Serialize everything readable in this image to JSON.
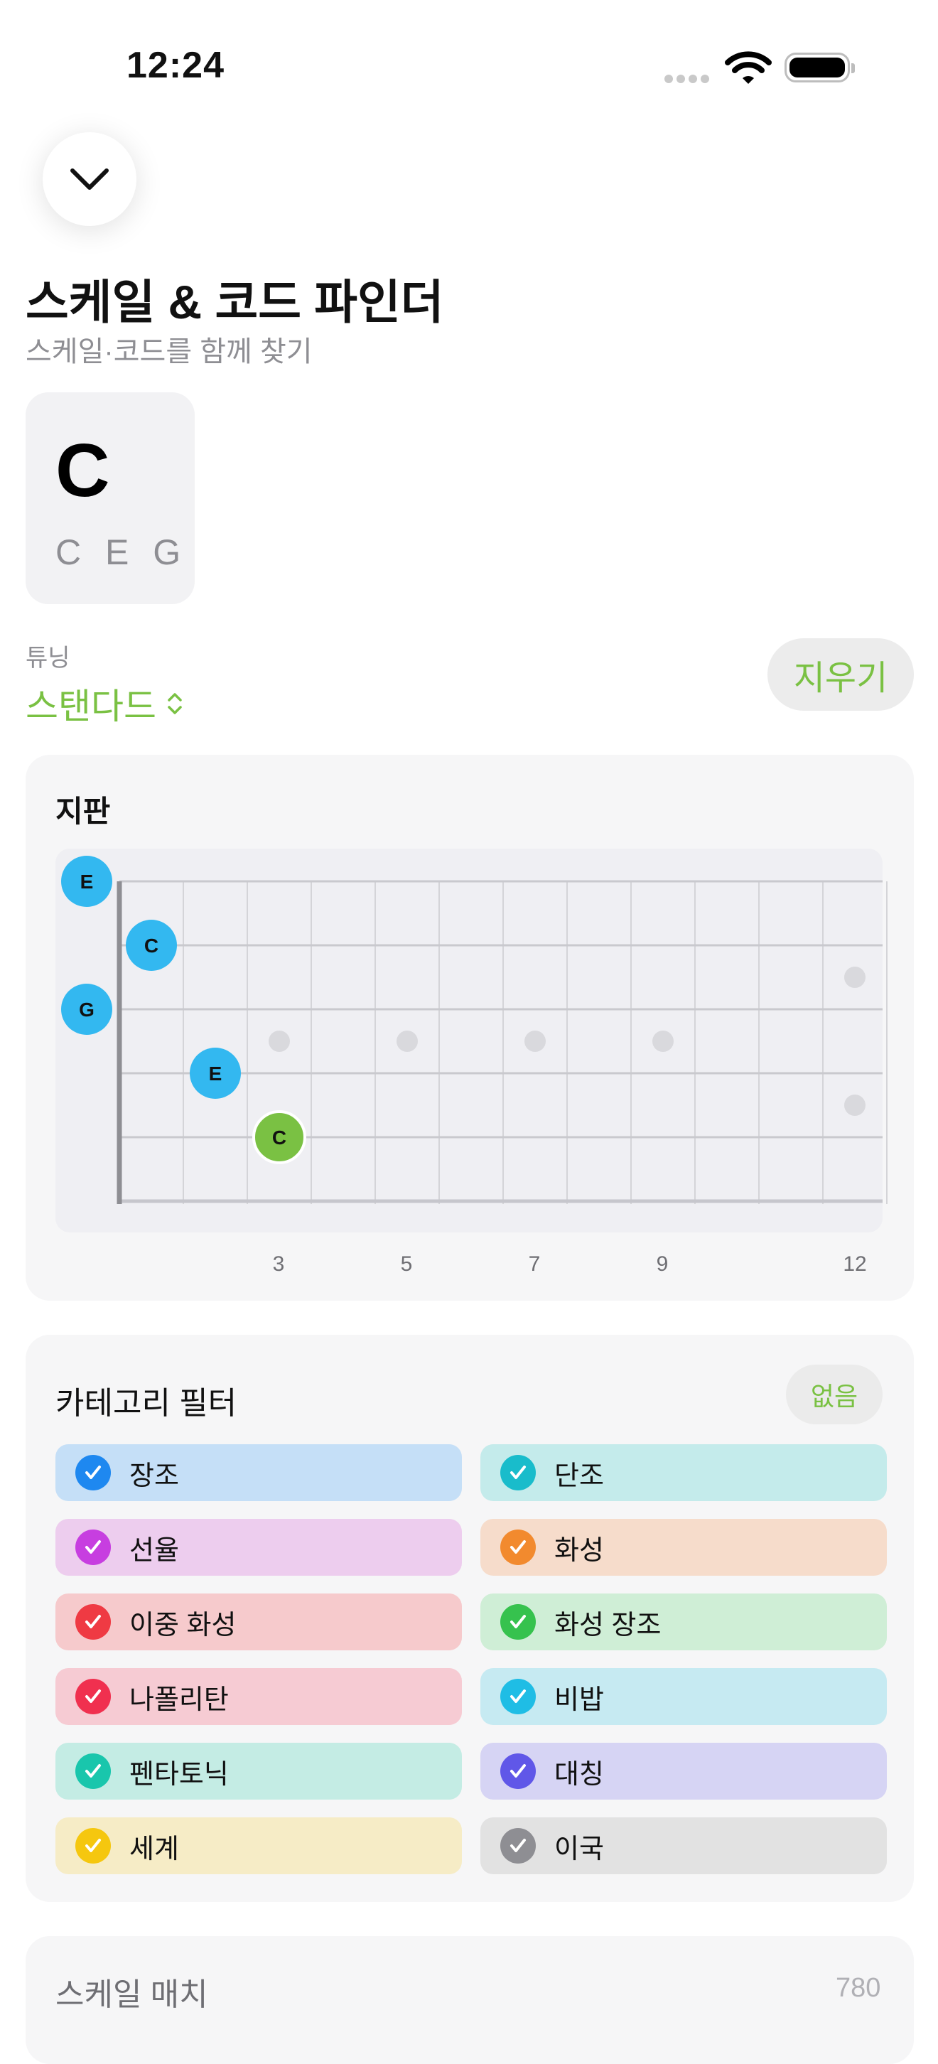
{
  "status_bar": {
    "time": "12:24"
  },
  "header": {
    "title": "스케일 & 코드 파인더",
    "subtitle": "스케일·코드를 함께 찾기"
  },
  "chord": {
    "name": "C",
    "notes": "C E G"
  },
  "tuning": {
    "label": "튜닝",
    "value": "스탠다드",
    "clear_label": "지우기"
  },
  "fretboard": {
    "title": "지판",
    "fret_numbers": [
      "3",
      "5",
      "7",
      "9",
      "12"
    ],
    "notes": [
      {
        "label": "E",
        "string": 1,
        "fret": 0,
        "color": "#33b8f0"
      },
      {
        "label": "C",
        "string": 2,
        "fret": 1,
        "color": "#33b8f0"
      },
      {
        "label": "G",
        "string": 3,
        "fret": 0,
        "color": "#33b8f0"
      },
      {
        "label": "E",
        "string": 4,
        "fret": 2,
        "color": "#33b8f0"
      },
      {
        "label": "C",
        "string": 5,
        "fret": 3,
        "color": "#7ac143"
      }
    ]
  },
  "filter": {
    "title": "카테고리 필터",
    "none_label": "없음",
    "categories": [
      {
        "label": "장조",
        "bg": "#c5dff7",
        "check": "#1e88f0"
      },
      {
        "label": "단조",
        "bg": "#c4ebeb",
        "check": "#19bccb"
      },
      {
        "label": "선율",
        "bg": "#edcdee",
        "check": "#c73ee0"
      },
      {
        "label": "화성",
        "bg": "#f6dccb",
        "check": "#f28a2e"
      },
      {
        "label": "이중 화성",
        "bg": "#f6cacc",
        "check": "#ef3a43"
      },
      {
        "label": "화성 장조",
        "bg": "#cfeed6",
        "check": "#36c24e"
      },
      {
        "label": "나폴리탄",
        "bg": "#f6cbd3",
        "check": "#f0304f"
      },
      {
        "label": "비밥",
        "bg": "#c6eaf2",
        "check": "#1fbde5"
      },
      {
        "label": "펜타토닉",
        "bg": "#c4ece4",
        "check": "#19c6ac"
      },
      {
        "label": "대칭",
        "bg": "#d6d4f4",
        "check": "#6057e8"
      },
      {
        "label": "세계",
        "bg": "#f6ecc6",
        "check": "#f5c70f"
      },
      {
        "label": "이국",
        "bg": "#e2e2e2",
        "check": "#8e8e93"
      }
    ]
  },
  "match": {
    "title": "스케일 매치",
    "count": "780"
  }
}
